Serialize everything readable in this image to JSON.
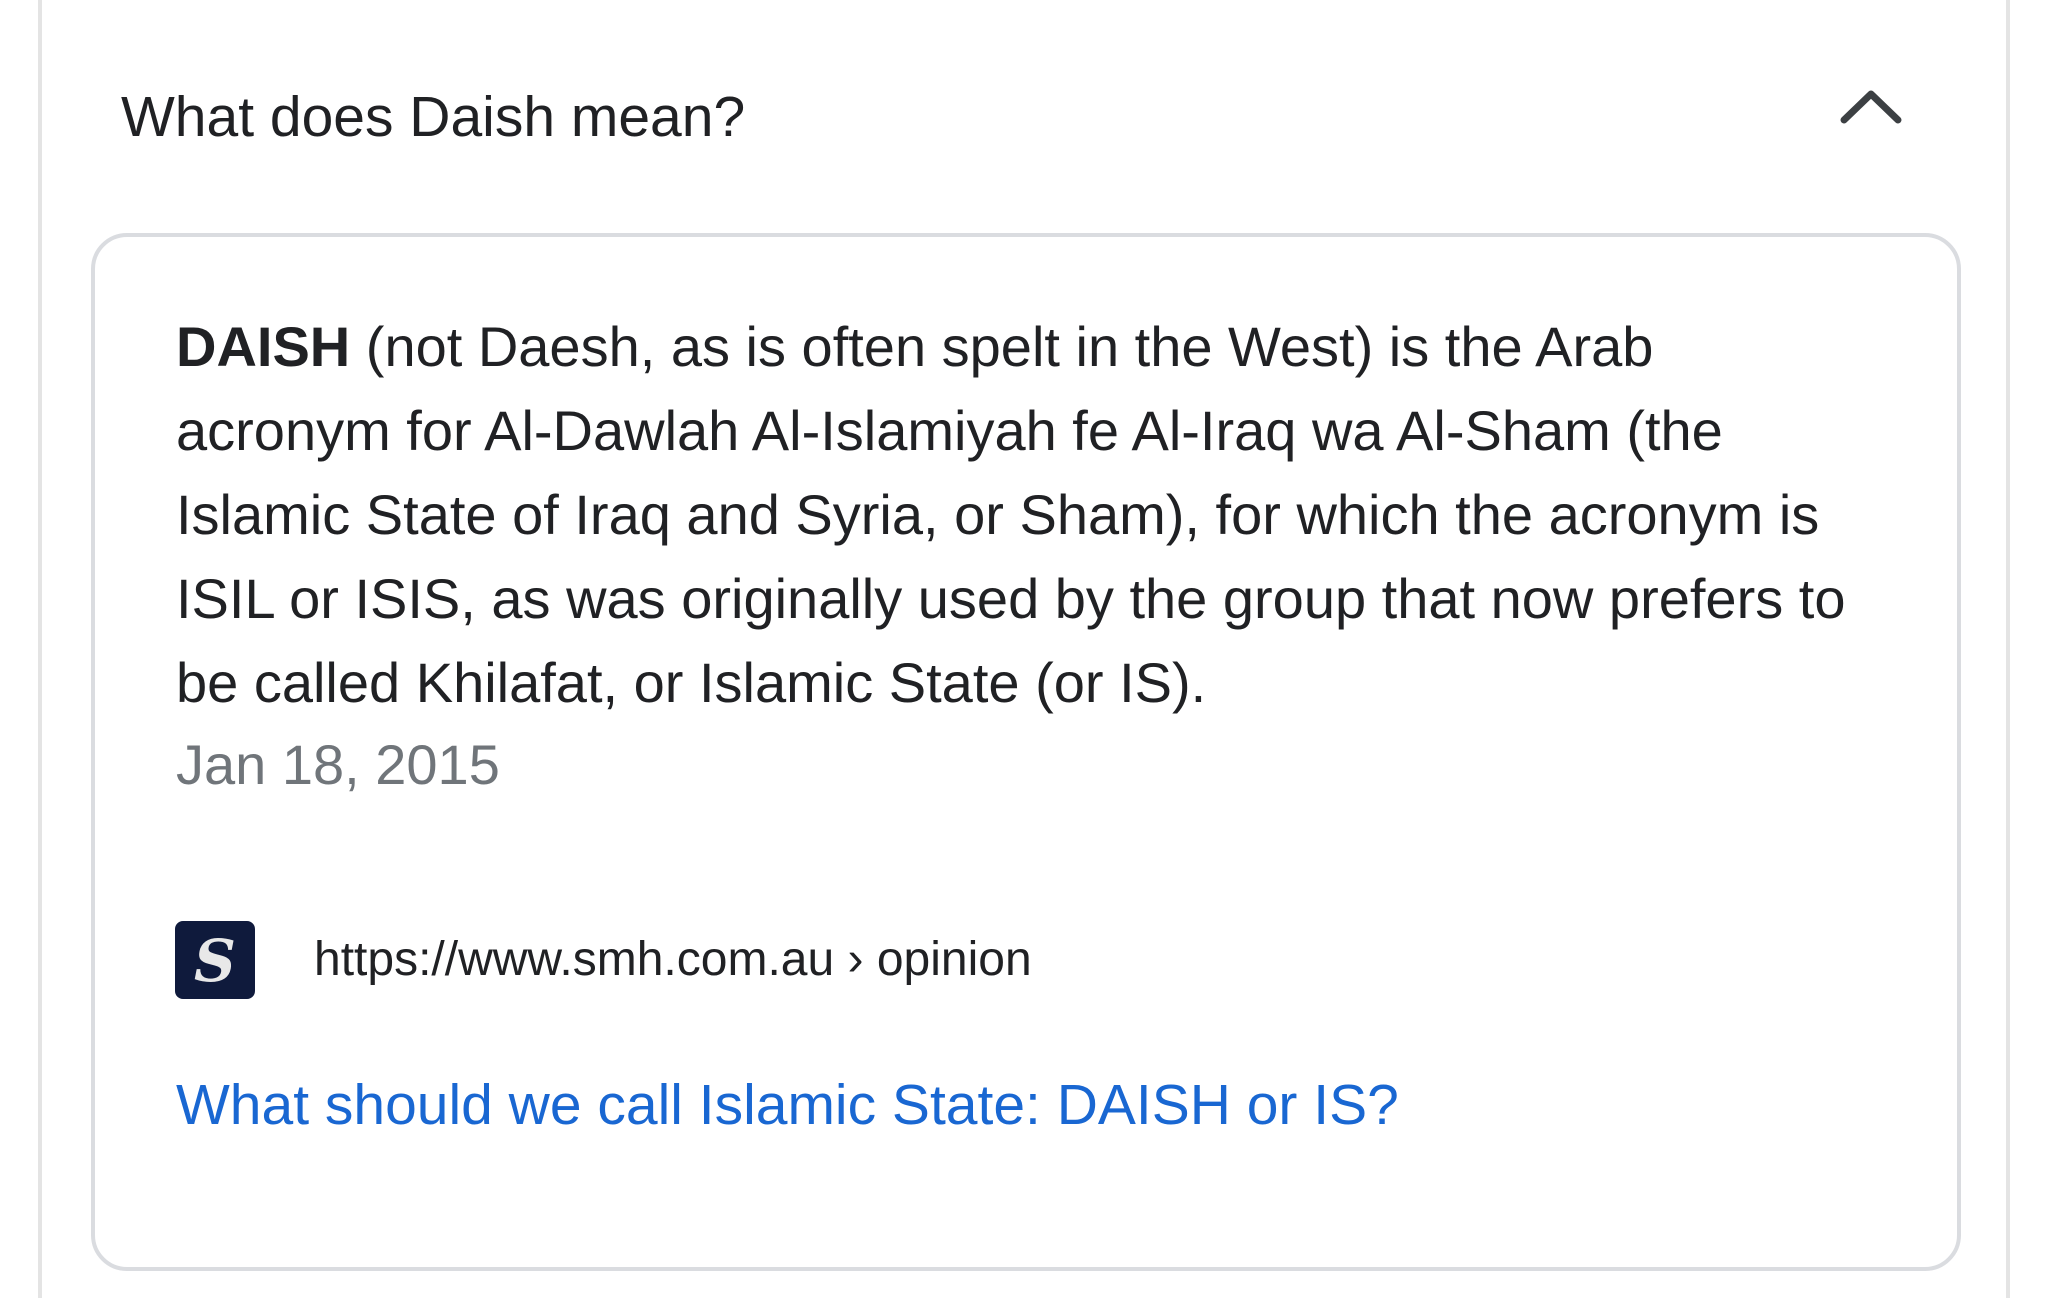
{
  "faq": {
    "question": "What does Daish mean?",
    "toggle_icon": "chevron-up-icon",
    "answer": {
      "bold_term": "DAISH",
      "text": " (not Daesh, as is often spelt in the West) is the Arab acronym for Al-Dawlah Al-Islamiyah fe Al-Iraq wa Al-Sham (the Islamic State of Iraq and Syria, or Sham), for which the acronym is ISIL or ISIS, as was originally used by the group that now prefers to be called Khilafat, or Islamic State (or IS).",
      "date": "Jan 18, 2015"
    },
    "source": {
      "favicon_letter": "S",
      "url": "https://www.smh.com.au › opinion",
      "title": "What should we call Islamic State: DAISH or IS?"
    }
  },
  "colors": {
    "text": "#202124",
    "muted": "#70757a",
    "link": "#1967d2",
    "border": "#dadce0",
    "favicon_bg": "#0f1a3c"
  }
}
